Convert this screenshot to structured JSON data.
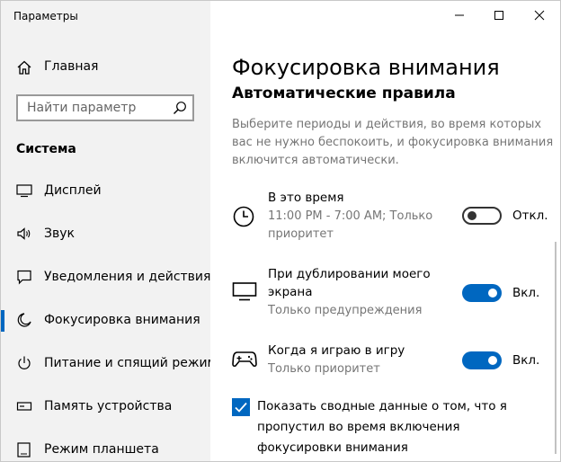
{
  "window": {
    "title": "Параметры",
    "controls": {
      "minimize": "minimize-icon",
      "maximize": "maximize-icon",
      "close": "close-icon"
    }
  },
  "sidebar": {
    "home_label": "Главная",
    "search_placeholder": "Найти параметр",
    "section_title": "Система",
    "items": [
      {
        "label": "Дисплей",
        "icon": "display-icon",
        "selected": false
      },
      {
        "label": "Звук",
        "icon": "speaker-icon",
        "selected": false
      },
      {
        "label": "Уведомления и действия",
        "icon": "notification-icon",
        "selected": false
      },
      {
        "label": "Фокусировка внимания",
        "icon": "moon-icon",
        "selected": true
      },
      {
        "label": "Питание и спящий режим",
        "icon": "power-icon",
        "selected": false
      },
      {
        "label": "Память устройства",
        "icon": "storage-icon",
        "selected": false
      },
      {
        "label": "Режим планшета",
        "icon": "tablet-icon",
        "selected": false
      }
    ]
  },
  "main": {
    "title": "Фокусировка внимания",
    "subheading": "Автоматические правила",
    "description": "Выберите периоды и действия, во время которых вас не нужно беспокоить, и фокусировка внимания включится автоматически.",
    "rules": [
      {
        "title": "В это время",
        "subtitle": "11:00 PM - 7:00 AM; Только приоритет",
        "state": "Откл.",
        "on": false,
        "icon": "clock-icon"
      },
      {
        "title": "При дублировании моего экрана",
        "subtitle": "Только предупреждения",
        "state": "Вкл.",
        "on": true,
        "icon": "monitor-icon"
      },
      {
        "title": "Когда я играю в игру",
        "subtitle": "Только приоритет",
        "state": "Вкл.",
        "on": true,
        "icon": "gamepad-icon"
      }
    ],
    "checkbox": {
      "label": "Показать сводные данные о том, что я пропустил во время включения фокусировки внимания",
      "checked": true
    }
  },
  "colors": {
    "accent": "#0067c0",
    "sidebar_bg": "#f2f2f2",
    "secondary_text": "#767676"
  }
}
